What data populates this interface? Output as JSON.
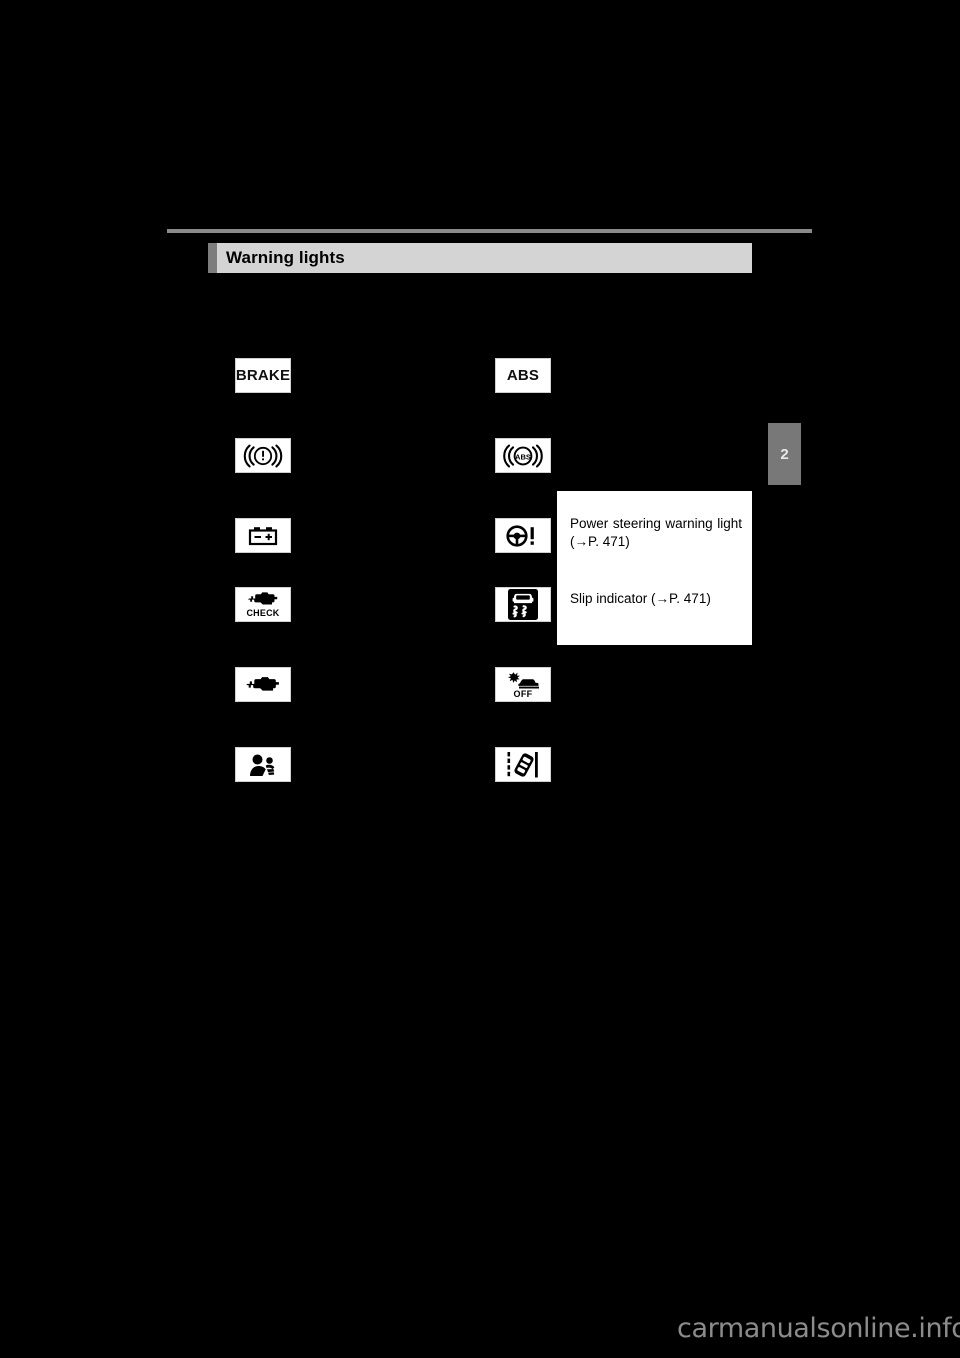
{
  "page": {
    "background_color": "#000000",
    "chapter_tab": "2",
    "watermark": "carmanualsonline.info"
  },
  "section": {
    "title": "Warning lights",
    "bar_color": "#d4d4d4",
    "accent_color": "#7d7d7d",
    "rule_color": "#8a8a8a"
  },
  "icons": {
    "left_column": [
      {
        "name": "brake-system-text-icon",
        "label": "BRAKE",
        "glyph": "text"
      },
      {
        "name": "brake-system-warning-icon",
        "label": "",
        "glyph": "brake-circle"
      },
      {
        "name": "charging-system-warning-icon",
        "label": "",
        "glyph": "battery"
      },
      {
        "name": "check-engine-icon",
        "label": "CHECK",
        "glyph": "engine-check"
      },
      {
        "name": "malfunction-indicator-icon",
        "label": "",
        "glyph": "engine"
      },
      {
        "name": "srs-airbag-warning-icon",
        "label": "",
        "glyph": "airbag"
      }
    ],
    "right_column": [
      {
        "name": "abs-text-icon",
        "label": "ABS",
        "glyph": "text"
      },
      {
        "name": "abs-warning-icon",
        "label": "ABS",
        "glyph": "abs-circle"
      },
      {
        "name": "power-steering-warning-icon",
        "label": "",
        "glyph": "steering-wheel"
      },
      {
        "name": "slip-indicator-icon",
        "label": "",
        "glyph": "slip"
      },
      {
        "name": "pre-collision-off-icon",
        "label": "OFF",
        "glyph": "pcs-off"
      },
      {
        "name": "lane-departure-alert-icon",
        "label": "",
        "glyph": "lane-departure"
      }
    ]
  },
  "callout": {
    "entries": [
      {
        "text": "Power  steering  warning light (→P. 471)"
      },
      {
        "text": "Slip indicator (→P. 471)"
      }
    ],
    "background_color": "#ffffff"
  }
}
